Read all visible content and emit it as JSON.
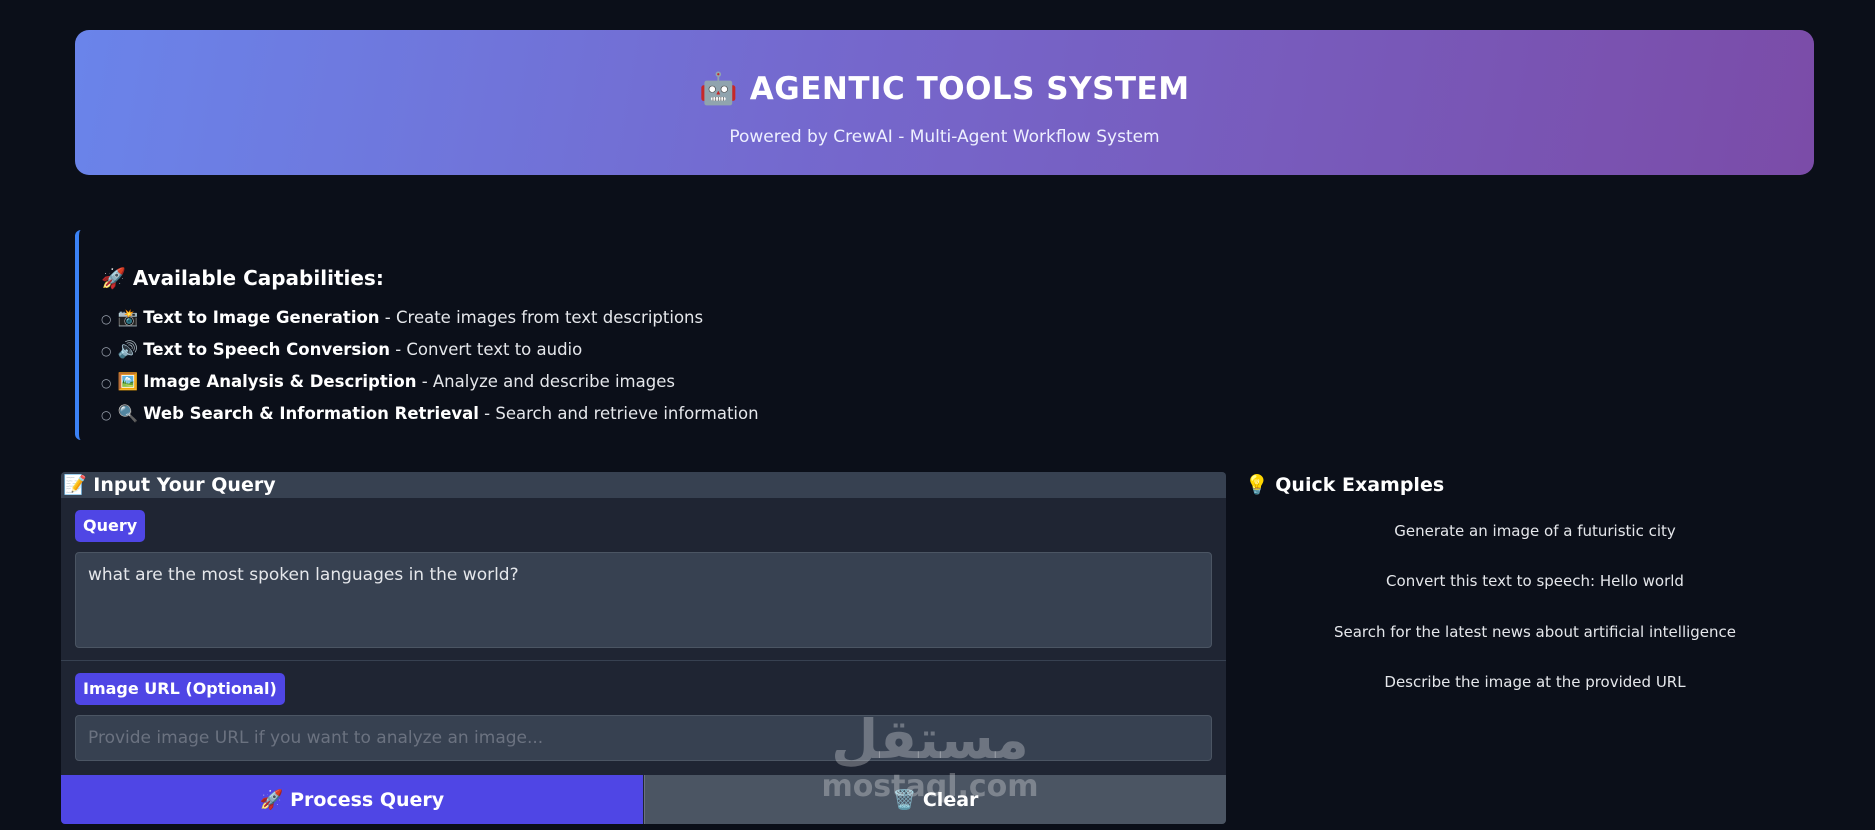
{
  "header": {
    "title": "🤖 AGENTIC TOOLS SYSTEM",
    "subtitle": "Powered by CrewAI - Multi-Agent Workflow System"
  },
  "capabilities": {
    "title": "🚀 Available Capabilities:",
    "bullet": "○",
    "items": [
      {
        "icon": "📸",
        "name": "Text to Image Generation",
        "desc": " - Create images from text descriptions"
      },
      {
        "icon": "🔊",
        "name": "Text to Speech Conversion",
        "desc": " - Convert text to audio"
      },
      {
        "icon": "🖼️",
        "name": "Image Analysis & Description",
        "desc": " - Analyze and describe images"
      },
      {
        "icon": "🔍",
        "name": "Web Search & Information Retrieval",
        "desc": " - Search and retrieve information"
      }
    ]
  },
  "input_panel": {
    "title": "📝 Input Your Query",
    "query_label": "Query",
    "query_value": "what are the most spoken languages in the world?",
    "image_label": "Image URL (Optional)",
    "image_placeholder": "Provide image URL if you want to analyze an image...",
    "process_button": "🚀 Process Query",
    "clear_button": "🗑️ Clear"
  },
  "examples": {
    "title": "💡 Quick Examples",
    "items": [
      "Generate an image of a futuristic city",
      "Convert this text to speech: Hello world",
      "Search for the latest news about artificial intelligence",
      "Describe the image at the provided URL"
    ]
  },
  "watermark": {
    "arabic": "مستقل",
    "latin": "mostaql.com"
  },
  "colors": {
    "background": "#0b0f19",
    "accent": "#4f46e5",
    "header_gradient_start": "#6a84ea",
    "header_gradient_end": "#7b4ca8",
    "capabilities_border": "#3b82f6"
  }
}
